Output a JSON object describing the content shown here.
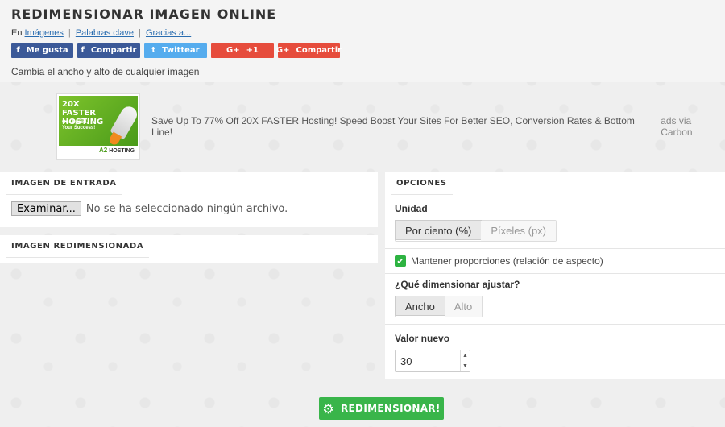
{
  "header": {
    "title": "REDIMENSIONAR IMAGEN ONLINE",
    "crumbs_prefix": "En",
    "crumbs": [
      "Imágenes",
      "Palabras clave",
      "Gracias a..."
    ],
    "separator": "|",
    "subtitle": "Cambia el ancho y alto de cualquier imagen"
  },
  "share": {
    "fb_like": {
      "icon": "f",
      "label": "Me gusta"
    },
    "fb_share": {
      "icon": "f",
      "label": "Compartir"
    },
    "twitter": {
      "icon": "t",
      "label": "Twittear"
    },
    "gplus_one": {
      "icon": "G+",
      "label": "+1"
    },
    "gplus_share": {
      "icon": "G+",
      "label": "Compartir"
    }
  },
  "ad": {
    "image_heading": "20X FASTER HOSTING",
    "image_tagline": "Our Speed, Your Success!",
    "image_logo_mark": "A2",
    "image_logo_text": "HOSTING",
    "text": "Save Up To 77% Off 20X FASTER Hosting! Speed Boost Your Sites For Better SEO, Conversion Rates & Bottom Line!",
    "via": "ads via Carbon"
  },
  "input_panel": {
    "title": "IMAGEN DE ENTRADA",
    "file_button": "Examinar...",
    "file_status": "No se ha seleccionado ningún archivo."
  },
  "resized_panel": {
    "title": "IMAGEN REDIMENSIONADA"
  },
  "options": {
    "title": "OPCIONES",
    "unit_label": "Unidad",
    "unit_options": [
      "Por ciento (%)",
      "Píxeles (px)"
    ],
    "unit_selected": "Por ciento (%)",
    "keep_ratio_label": "Mantener proporciones (relación de aspecto)",
    "keep_ratio_checked": true,
    "dimension_label": "¿Qué dimensionar ajustar?",
    "dimension_options": [
      "Ancho",
      "Alto"
    ],
    "dimension_selected": "Ancho",
    "value_label": "Valor nuevo",
    "value": "30"
  },
  "resize_button": {
    "label": "REDIMENSIONAR!",
    "icon": "gear-icon"
  },
  "colors": {
    "facebook": "#3b5998",
    "twitter": "#55acee",
    "googleplus": "#e64c3c",
    "accent_green": "#39b54a",
    "link": "#2a6db0"
  }
}
